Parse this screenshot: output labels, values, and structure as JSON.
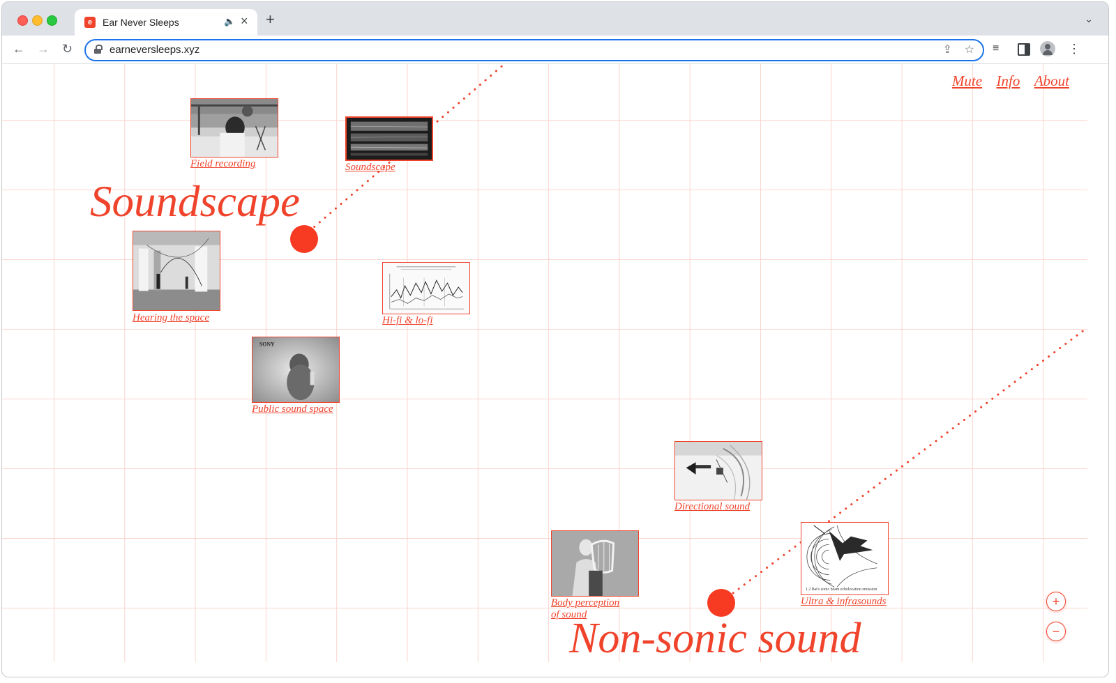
{
  "browser": {
    "tab_title": "Ear Never Sleeps",
    "url": "earneversleeps.xyz",
    "icons": {
      "favicon": "ear-icon",
      "audio": "speaker-icon",
      "close": "close-icon",
      "new_tab": "plus-icon",
      "back": "arrow-left-icon",
      "forward": "arrow-right-icon",
      "reload": "reload-icon",
      "lock": "lock-icon",
      "share": "share-icon",
      "bookmark": "star-icon",
      "media": "media-controls-icon",
      "side_panel": "side-panel-icon",
      "profile": "avatar-icon",
      "menu": "kebab-icon"
    }
  },
  "nav": {
    "mute": "Mute",
    "info": "Info",
    "about": "About"
  },
  "groups": {
    "soundscape_title": "Soundscape",
    "nonsonic_title": "Non-sonic sound"
  },
  "cards": {
    "field_recording": "Field recording",
    "soundscape": "Soundscape",
    "hearing_the_space": "Hearing the space",
    "hifi_lofi": "Hi-fi & lo-fi",
    "public_sound_space": "Public sound space",
    "directional_sound": "Directional sound",
    "body_perception_line1": "Body perception",
    "body_perception_line2": "of sound",
    "ultra_infrasounds": "Ultra & infrasounds",
    "bat_caption": "1.2 Bat's sonic beam echolocation emission",
    "sony_label": "SONY"
  },
  "zoom": {
    "in": "+",
    "out": "−"
  },
  "colors": {
    "accent": "#f0432b",
    "grid": "#fbd5cf",
    "dot": "#f73b22"
  }
}
